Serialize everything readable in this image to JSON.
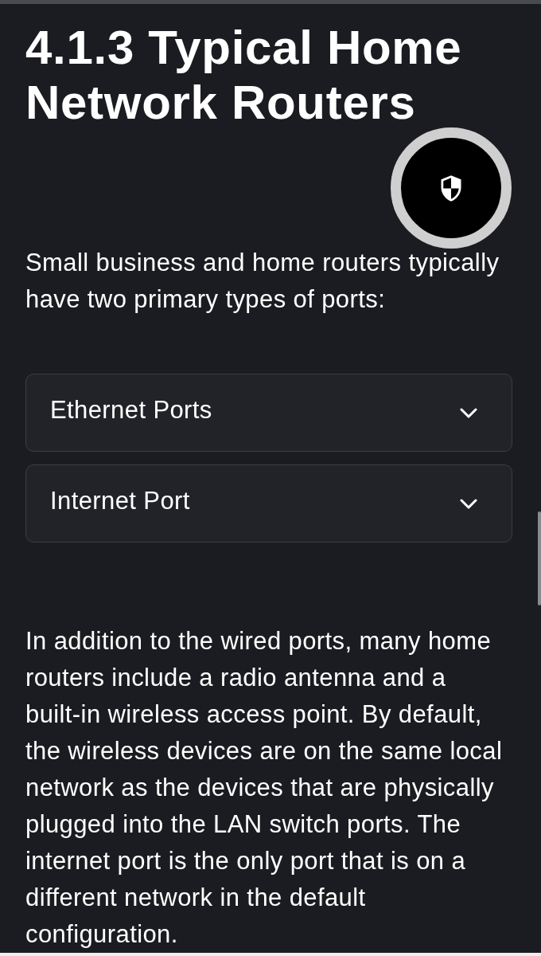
{
  "heading": "4.1.3 Typical Home Network Routers",
  "intro": "Small business and home routers typically have two primary types of ports:",
  "accordion": [
    {
      "label": "Ethernet Ports",
      "expanded": false
    },
    {
      "label": "Internet Port",
      "expanded": false
    }
  ],
  "body": "In addition to the wired ports, many home routers include a radio antenna and a built-in wireless access point. By default, the wireless devices are on the same local network as the devices that are physically plugged into the LAN switch ports. The internet port is the only port that is on a different network in the default configuration."
}
